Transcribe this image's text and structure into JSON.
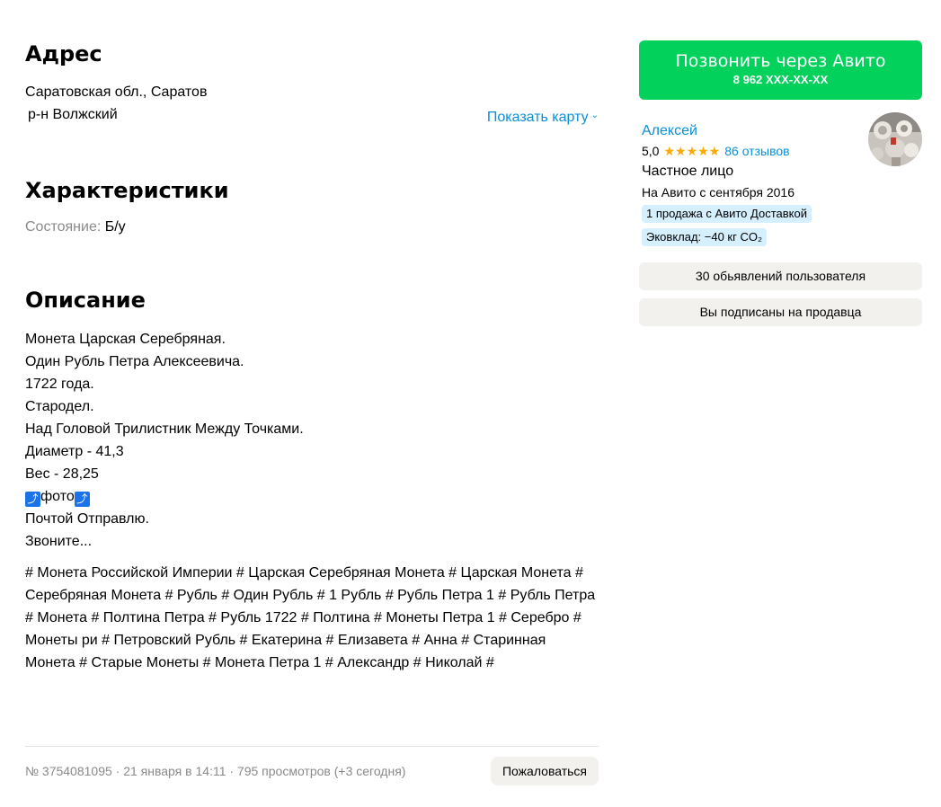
{
  "address": {
    "title": "Адрес",
    "line1": "Саратовская обл., Саратов",
    "line2": "р-н Волжский",
    "map_link": "Показать карту"
  },
  "characteristics": {
    "title": "Характеристики",
    "condition_label": "Состояние:",
    "condition_value": "Б/у"
  },
  "description": {
    "title": "Описание",
    "lines": [
      "Монета Царская Серебряная.",
      "Один Рубль Петра Алексеевича.",
      "1722 года.",
      "Стародел.",
      "Над Головой Трилистник Между Точками.",
      "Диаметр - 41,3",
      "Вес - 28,25",
      "фото",
      "Почтой Отправлю.",
      "Звоните..."
    ],
    "photo_arrow": "⤴",
    "tags": "# Монета Российской Империи # Царская Серебряная Монета # Царская Монета # Серебряная Монета # Рубль # Один Рубль # 1 Рубль # Рубль Петра 1 # Рубль Петра # Монета # Полтина Петра # Рубль 1722 # Полтина # Монеты Петра 1 # Серебро # Монеты ри # Петровский Рубль # Екатерина # Елизавета # Анна # Старинная Монета # Старые Монеты # Монета Петра 1 # Александр # Николай #"
  },
  "footer": {
    "meta": "№ 3754081095 · 21 января в 14:11 · 795 просмотров (+3 сегодня)",
    "report_button": "Пожаловаться"
  },
  "call": {
    "label": "Позвонить через Авито",
    "phone": "8 962 XXX-XX-XX"
  },
  "seller": {
    "name": "Алексей",
    "rating": "5,0",
    "stars": "★★★★★",
    "reviews": "86 отзывов",
    "type": "Частное лицо",
    "since": "На Авито с сентября 2016",
    "badge_delivery": "1 продажа с Авито Доставкой",
    "badge_eco": "Эковклад: −40 кг CO₂"
  },
  "actions": {
    "listings": "30 обьявлений пользователя",
    "subscribed": "Вы подписаны на продавца"
  },
  "colors": {
    "accent_link": "#0a8fd8",
    "call_green": "#02d15c",
    "badge_blue": "#d5efff",
    "gray_button": "#f2f1ed",
    "star": "#ffa800"
  }
}
